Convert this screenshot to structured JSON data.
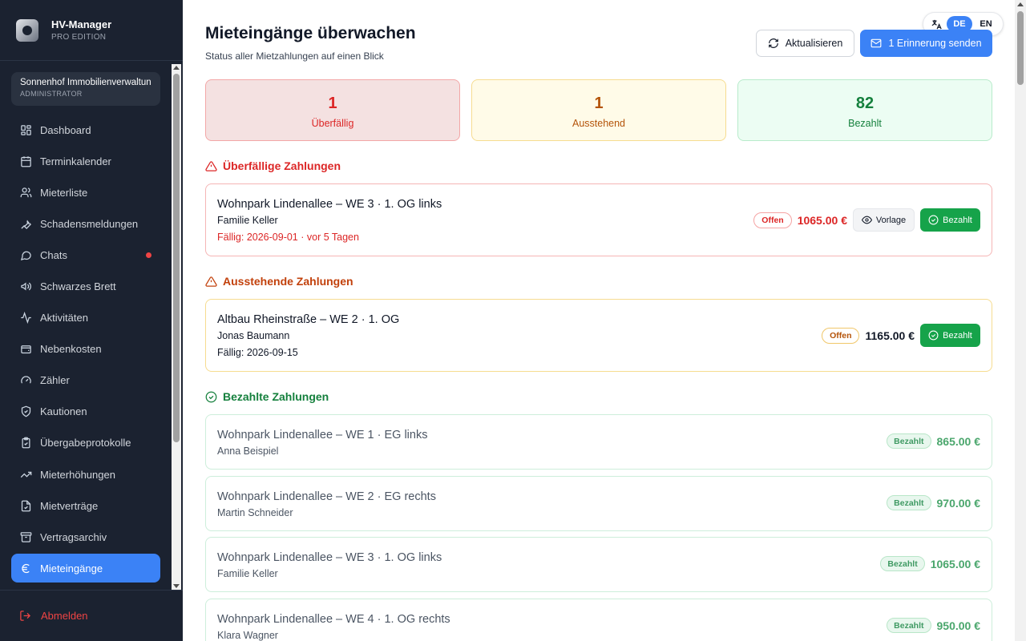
{
  "brand": {
    "name": "HV-Manager",
    "edition": "PRO EDITION"
  },
  "org": {
    "name": "Sonnenhof Immobilienverwaltung",
    "role": "ADMINISTRATOR"
  },
  "nav": [
    {
      "label": "Dashboard",
      "icon": "dashboard-icon"
    },
    {
      "label": "Terminkalender",
      "icon": "calendar-icon"
    },
    {
      "label": "Mieterliste",
      "icon": "users-icon"
    },
    {
      "label": "Schadensmeldungen",
      "icon": "wrench-icon"
    },
    {
      "label": "Chats",
      "icon": "chat-icon",
      "unread": true
    },
    {
      "label": "Schwarzes Brett",
      "icon": "megaphone-icon"
    },
    {
      "label": "Aktivitäten",
      "icon": "activity-icon"
    },
    {
      "label": "Nebenkosten",
      "icon": "wallet-icon"
    },
    {
      "label": "Zähler",
      "icon": "gauge-icon"
    },
    {
      "label": "Kautionen",
      "icon": "shield-icon"
    },
    {
      "label": "Übergabeprotokolle",
      "icon": "clipboard-icon"
    },
    {
      "label": "Mieterhöhungen",
      "icon": "trending-up-icon"
    },
    {
      "label": "Mietverträge",
      "icon": "file-check-icon"
    },
    {
      "label": "Vertragsarchiv",
      "icon": "archive-icon"
    },
    {
      "label": "Mieteingänge",
      "icon": "euro-icon",
      "active": true
    }
  ],
  "logout": "Abmelden",
  "header": {
    "title": "Mieteingänge überwachen",
    "subtitle": "Status aller Mietzahlungen auf einen Blick",
    "refresh_label": "Aktualisieren",
    "remind_label": "1 Erinnerung senden"
  },
  "lang": {
    "de": "DE",
    "en": "EN",
    "active": "DE"
  },
  "stats": {
    "overdue": {
      "value": "1",
      "label": "Überfällig"
    },
    "pending": {
      "value": "1",
      "label": "Ausstehend"
    },
    "paid": {
      "value": "82",
      "label": "Bezahlt"
    }
  },
  "sections": {
    "overdue": "Überfällige Zahlungen",
    "pending": "Ausstehende Zahlungen",
    "paid": "Bezahlte Zahlungen"
  },
  "overdue_payments": [
    {
      "property": "Wohnpark Lindenallee – WE 3 · 1. OG links",
      "tenant": "Familie Keller",
      "due": "Fällig: 2026-09-01 · vor 5 Tagen",
      "status": "Offen",
      "amount": "1065.00 €",
      "template_label": "Vorlage",
      "paid_label": "Bezahlt"
    }
  ],
  "pending_payments": [
    {
      "property": "Altbau Rheinstraße – WE 2 · 1. OG",
      "tenant": "Jonas Baumann",
      "due": "Fällig: 2026-09-15",
      "status": "Offen",
      "amount": "1165.00 €",
      "paid_label": "Bezahlt"
    }
  ],
  "paid_payments": [
    {
      "property": "Wohnpark Lindenallee – WE 1 · EG links",
      "tenant": "Anna Beispiel",
      "status": "Bezahlt",
      "amount": "865.00 €"
    },
    {
      "property": "Wohnpark Lindenallee – WE 2 · EG rechts",
      "tenant": "Martin Schneider",
      "status": "Bezahlt",
      "amount": "970.00 €"
    },
    {
      "property": "Wohnpark Lindenallee – WE 3 · 1. OG links",
      "tenant": "Familie Keller",
      "status": "Bezahlt",
      "amount": "1065.00 €"
    },
    {
      "property": "Wohnpark Lindenallee – WE 4 · 1. OG rechts",
      "tenant": "Klara Wagner",
      "status": "Bezahlt",
      "amount": "950.00 €"
    }
  ],
  "colors": {
    "accent": "#3b82f6",
    "sidebar": "#1b2230",
    "danger": "#dc2626",
    "warning": "#b45309",
    "success": "#16a34a"
  }
}
